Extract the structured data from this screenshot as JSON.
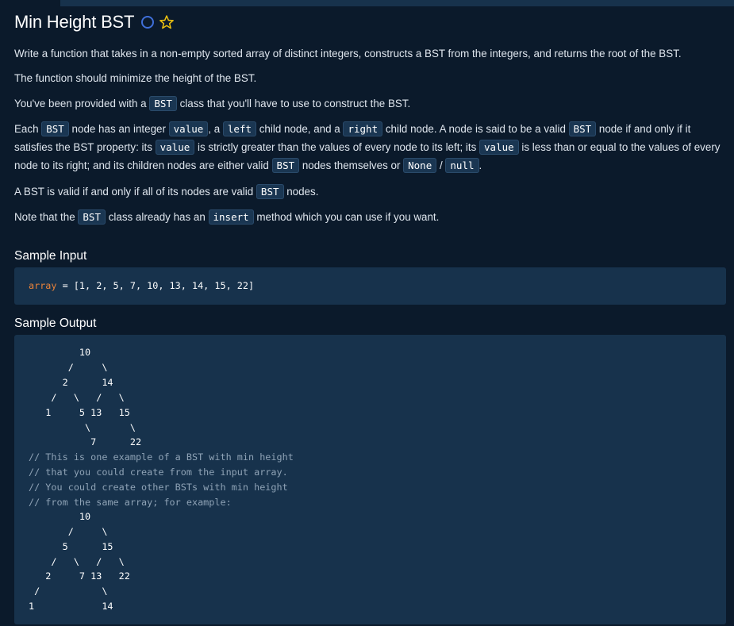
{
  "title": "Min Height BST",
  "icons": {
    "status": "circle-icon",
    "favorite": "star-icon"
  },
  "colors": {
    "background": "#0b1a2b",
    "panel": "#17324c",
    "accent_circle": "#3f6fd9",
    "star": "#f1c40f",
    "variable": "#e8823a",
    "comment": "#8fa3b6"
  },
  "desc": {
    "p1": "Write a function that takes in a non-empty sorted array of distinct integers, constructs a BST from the integers, and returns the root of the BST.",
    "p2": "The function should minimize the height of the BST.",
    "p3": [
      "You've been provided with a ",
      "BST",
      " class that you'll have to use to construct the BST."
    ],
    "p4": [
      "Each ",
      "BST",
      " node has an integer ",
      "value",
      ", a ",
      "left",
      " child node, and a ",
      "right",
      " child node. A node is said to be a valid ",
      "BST",
      " node if and only if it satisfies the BST property: its ",
      "value",
      " is strictly greater than the values of every node to its left; its ",
      "value",
      " is less than or equal to the values of every node to its right; and its children nodes are either valid ",
      "BST",
      " nodes themselves or ",
      "None",
      " / ",
      "null",
      "."
    ],
    "p5": [
      "A BST is valid if and only if all of its nodes are valid ",
      "BST",
      " nodes."
    ],
    "p6": [
      "Note that the ",
      "BST",
      " class already has an ",
      "insert",
      " method which you can use if you want."
    ]
  },
  "sample_input": {
    "title": "Sample Input",
    "var": "array",
    "rest": " = [1, 2, 5, 7, 10, 13, 14, 15, 22]"
  },
  "sample_output": {
    "title": "Sample Output",
    "lines": [
      "         10",
      "       /     \\",
      "      2      14",
      "    /   \\   /   \\",
      "   1     5 13   15",
      "          \\       \\",
      "           7      22",
      "// This is one example of a BST with min height",
      "// that you could create from the input array.",
      "// You could create other BSTs with min height",
      "// from the same array; for example:",
      "         10",
      "       /     \\",
      "      5      15",
      "    /   \\   /   \\",
      "   2     7 13   22",
      " /           \\",
      "1            14"
    ]
  }
}
